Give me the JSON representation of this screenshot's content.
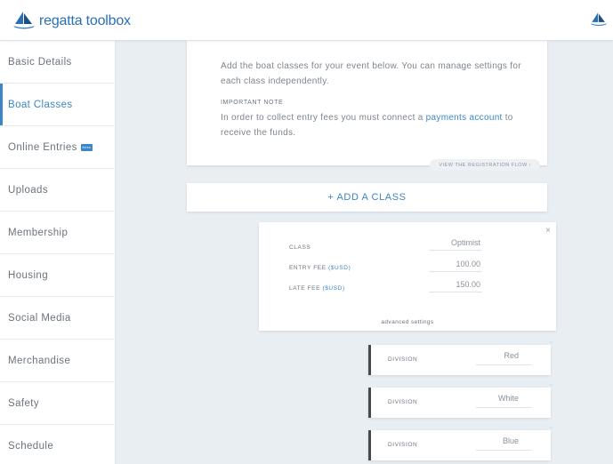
{
  "app": {
    "name": "regatta toolbox"
  },
  "sidebar": {
    "items": [
      {
        "label": "Basic Details",
        "active": false
      },
      {
        "label": "Boat Classes",
        "active": true
      },
      {
        "label": "Online Entries",
        "active": false,
        "badge": "beta"
      },
      {
        "label": "Uploads",
        "active": false
      },
      {
        "label": "Membership",
        "active": false
      },
      {
        "label": "Housing",
        "active": false
      },
      {
        "label": "Social Media",
        "active": false
      },
      {
        "label": "Merchandise",
        "active": false
      },
      {
        "label": "Safety",
        "active": false
      },
      {
        "label": "Schedule",
        "active": false
      }
    ]
  },
  "intro": {
    "text": "Add the boat classes for your event below. You can manage settings for each class independently.",
    "note_heading": "IMPORTANT NOTE",
    "note_before": "In order to collect entry fees you must connect a ",
    "note_link": "payments account",
    "note_after": " to receive the funds.",
    "flow_button": "VIEW THE REGISTRATION FLOW ›"
  },
  "add_class": {
    "label": "+ ADD A CLASS"
  },
  "class_card": {
    "close": "×",
    "class_label": "CLASS",
    "class_value": "Optimist",
    "entry_fee_label": "ENTRY FEE",
    "entry_fee_unit": "($USD)",
    "entry_fee_value": "100.00",
    "late_fee_label": "LATE FEE",
    "late_fee_unit": "($USD)",
    "late_fee_value": "150.00",
    "advanced": "advanced settings"
  },
  "divisions": [
    {
      "label": "DIVISION",
      "value": "Red"
    },
    {
      "label": "DIVISION",
      "value": "White"
    },
    {
      "label": "DIVISION",
      "value": "Blue"
    }
  ],
  "colors": {
    "accent": "#3b86c8",
    "text": "#6a7480",
    "background": "#e9eef3"
  }
}
